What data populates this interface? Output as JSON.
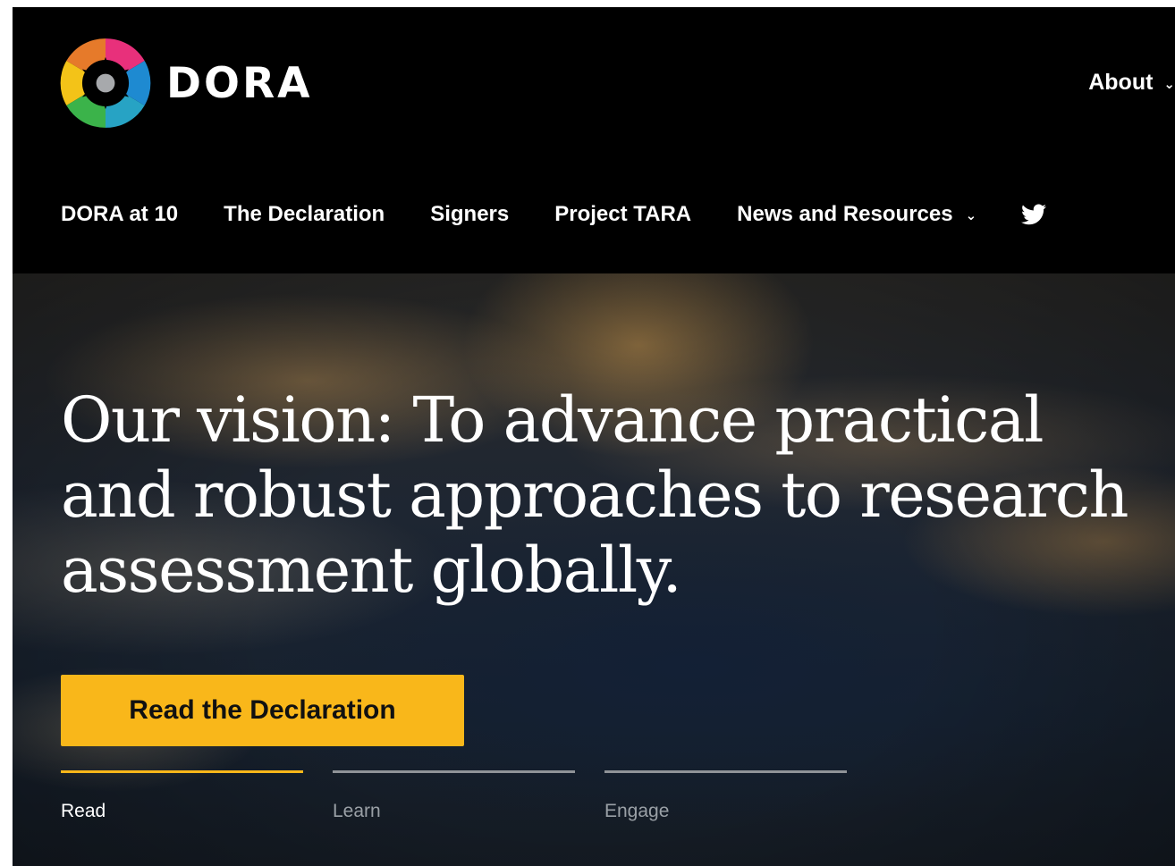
{
  "brand": {
    "name": "DORA"
  },
  "topnav": {
    "about_label": "About"
  },
  "nav": {
    "items": [
      {
        "label": "DORA at 10"
      },
      {
        "label": "The Declaration"
      },
      {
        "label": "Signers"
      },
      {
        "label": "Project TARA"
      },
      {
        "label": "News and Resources",
        "has_dropdown": true
      }
    ],
    "social_icon": "twitter-icon"
  },
  "hero": {
    "heading": "Our vision: To advance practical and robust approaches to research assessment globally.",
    "cta_label": "Read the Declaration",
    "tabs": [
      {
        "label": "Read",
        "active": true
      },
      {
        "label": "Learn",
        "active": false
      },
      {
        "label": "Engage",
        "active": false
      }
    ]
  },
  "colors": {
    "accent": "#f9b71a",
    "nav_background": "#000000",
    "tab_inactive": "#8f9398",
    "logo_segments": [
      "#e8307b",
      "#e67a2a",
      "#f3c318",
      "#3bb34a",
      "#27a3c4",
      "#1e8ad1"
    ]
  }
}
